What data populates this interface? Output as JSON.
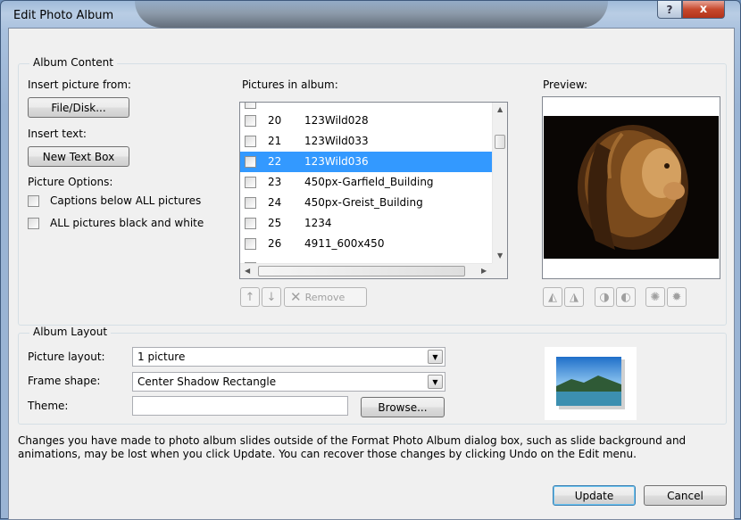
{
  "window": {
    "title": "Edit Photo Album",
    "help_glyph": "?",
    "close_glyph": "x"
  },
  "album_content": {
    "group_label": "Album Content",
    "insert_picture_label": "Insert picture from:",
    "file_disk_button": "File/Disk...",
    "insert_text_label": "Insert text:",
    "new_text_box_button": "New Text Box",
    "picture_options_label": "Picture Options:",
    "captions_option": "Captions below ALL pictures",
    "bw_option": "ALL pictures black and white",
    "pictures_in_album_label": "Pictures in album:",
    "preview_label": "Preview:",
    "pictures": [
      {
        "num": "20",
        "name": "123Wild028",
        "selected": false
      },
      {
        "num": "21",
        "name": "123Wild033",
        "selected": false
      },
      {
        "num": "22",
        "name": "123Wild036",
        "selected": true
      },
      {
        "num": "23",
        "name": "450px-Garfield_Building",
        "selected": false
      },
      {
        "num": "24",
        "name": "450px-Greist_Building",
        "selected": false
      },
      {
        "num": "25",
        "name": "1234",
        "selected": false
      },
      {
        "num": "26",
        "name": "4911_600x450",
        "selected": false
      }
    ],
    "remove_button": "Remove"
  },
  "album_layout": {
    "group_label": "Album Layout",
    "picture_layout_label": "Picture layout:",
    "picture_layout_value": "1 picture",
    "frame_shape_label": "Frame shape:",
    "frame_shape_value": "Center Shadow Rectangle",
    "theme_label": "Theme:",
    "theme_value": "",
    "browse_button": "Browse..."
  },
  "notice": "Changes you have made to photo album slides outside of the Format Photo Album dialog box, such as slide background and animations, may be lost when you click Update. You can recover those changes by clicking Undo on the Edit menu.",
  "footer": {
    "update_button": "Update",
    "cancel_button": "Cancel"
  },
  "icons": [
    "up-arrow-icon",
    "down-arrow-icon",
    "remove-x-icon",
    "rotate-left-icon",
    "rotate-right-icon",
    "contrast-up-icon",
    "contrast-down-icon",
    "brightness-up-icon",
    "brightness-down-icon"
  ]
}
